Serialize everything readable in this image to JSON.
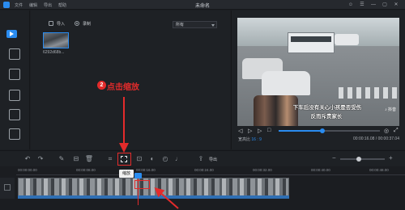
{
  "titlebar": {
    "menus": [
      "文件",
      "编辑",
      "导出",
      "帮助"
    ],
    "title": "未命名",
    "window_buttons": [
      "☺",
      "☰",
      "—",
      "▢",
      "✕"
    ]
  },
  "media": {
    "import_label": "导入",
    "record_label": "录制",
    "filter_value": "所有",
    "thumbnail_name": "6292d68b..."
  },
  "preview": {
    "subtitle_line1": "下车后没有关心小孩是否受伤",
    "subtitle_line2": "反而斥责家长",
    "watermark": "♪ 抖音",
    "aspect_label": "宽高比",
    "aspect_value": "16 : 9",
    "timecode": "00:00:16.08 / 00:00:37.04",
    "progress": 0.43
  },
  "toolbar": {
    "export_label": "导出",
    "tooltip": "缩放"
  },
  "timeline": {
    "ticks": [
      "00:00:00.00",
      "00:00:08.00",
      "00:00:16.00",
      "00:00:24.00",
      "00:00:32.00",
      "00:00:40.00",
      "00:00:48.00"
    ]
  },
  "annotation": {
    "step": "2",
    "text": "点击缩放"
  },
  "colors": {
    "accent": "#2a8cf0",
    "annotation": "#e32b2b"
  }
}
